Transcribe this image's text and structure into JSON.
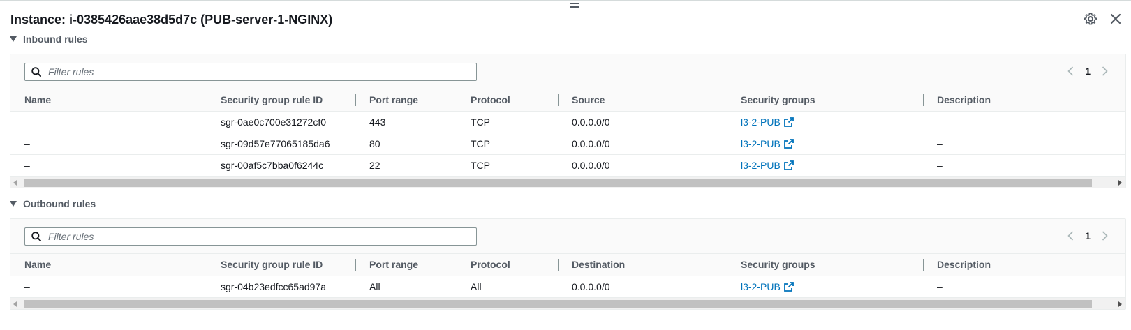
{
  "panel": {
    "title": "Instance: i-0385426aae38d5d7c (PUB-server-1-NGINX)"
  },
  "icons": {
    "settings": "gear-icon",
    "close": "close-icon",
    "search": "search-icon",
    "external_link": "external-link-icon",
    "expand": "caret-down-icon",
    "prev": "chevron-left-icon",
    "next": "chevron-right-icon"
  },
  "colors": {
    "link": "#0073bb",
    "header_text": "#545b64",
    "text": "#16191f"
  },
  "inbound": {
    "title": "Inbound rules",
    "filter_placeholder": "Filter rules",
    "page": "1",
    "columns": [
      "Name",
      "Security group rule ID",
      "Port range",
      "Protocol",
      "Source",
      "Security groups",
      "Description"
    ],
    "rows": [
      {
        "name": "–",
        "rule_id": "sgr-0ae0c700e31272cf0",
        "port": "443",
        "protocol": "TCP",
        "source": "0.0.0.0/0",
        "group": "l3-2-PUB",
        "description": "–"
      },
      {
        "name": "–",
        "rule_id": "sgr-09d57e77065185da6",
        "port": "80",
        "protocol": "TCP",
        "source": "0.0.0.0/0",
        "group": "l3-2-PUB",
        "description": "–"
      },
      {
        "name": "–",
        "rule_id": "sgr-00af5c7bba0f6244c",
        "port": "22",
        "protocol": "TCP",
        "source": "0.0.0.0/0",
        "group": "l3-2-PUB",
        "description": "–"
      }
    ]
  },
  "outbound": {
    "title": "Outbound rules",
    "filter_placeholder": "Filter rules",
    "page": "1",
    "columns": [
      "Name",
      "Security group rule ID",
      "Port range",
      "Protocol",
      "Destination",
      "Security groups",
      "Description"
    ],
    "rows": [
      {
        "name": "–",
        "rule_id": "sgr-04b23edfcc65ad97a",
        "port": "All",
        "protocol": "All",
        "source": "0.0.0.0/0",
        "group": "l3-2-PUB",
        "description": "–"
      }
    ]
  }
}
